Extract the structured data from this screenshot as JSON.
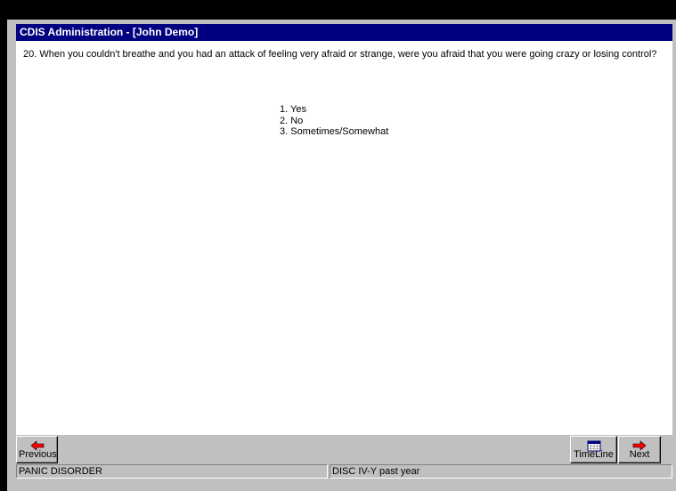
{
  "window": {
    "title": "CDIS Administration - [John Demo]"
  },
  "question": {
    "text": "20. When you couldn't breathe and you had an attack of feeling very afraid or strange, were you afraid that you were going crazy or losing control?"
  },
  "answers": [
    {
      "label": "1. Yes"
    },
    {
      "label": "2. No"
    },
    {
      "label": "3. Sometimes/Somewhat"
    }
  ],
  "buttons": {
    "previous": {
      "label": "Previous",
      "icon": "left-arrow-icon"
    },
    "timeline": {
      "label": "TimeLine",
      "icon": "calendar-icon"
    },
    "next": {
      "label": "Next",
      "icon": "right-arrow-icon"
    }
  },
  "status": {
    "section": "PANIC DISORDER",
    "interview": "DISC IV-Y past year"
  },
  "colors": {
    "titlebar": "#000080",
    "arrow": "#ff0000",
    "background": "#c0c0c0"
  }
}
